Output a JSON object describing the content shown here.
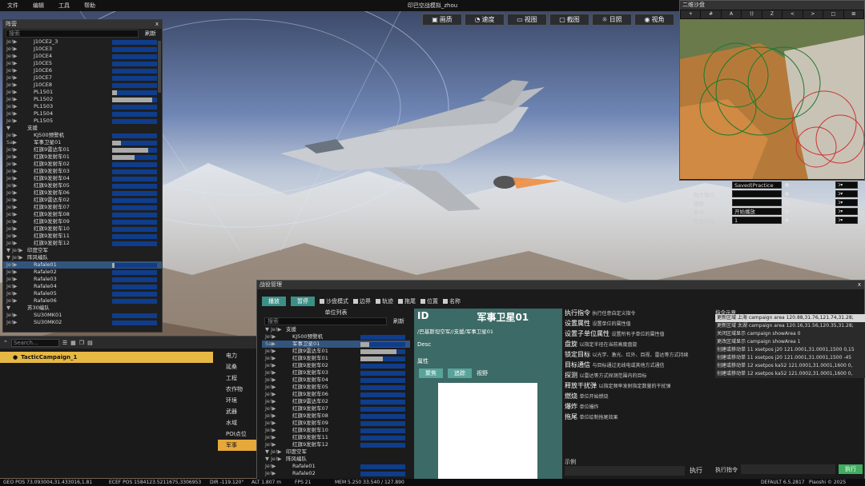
{
  "menu": {
    "items": [
      "文件",
      "编辑",
      "工具",
      "帮助"
    ],
    "title": "印巴空战模拟_zhou",
    "window_controls": [
      "—",
      "□",
      "✕"
    ]
  },
  "toolbar": [
    "画质",
    "速度",
    "视图",
    "截图",
    "日照",
    "视角"
  ],
  "formation_panel": {
    "title": "阵营",
    "close": "x",
    "search_placeholder": "搜索",
    "refresh": "刷新",
    "rows": [
      {
        "prefix": "Je!▶",
        "label": "J10CE2_3",
        "fill": 0
      },
      {
        "prefix": "Je!▶",
        "label": "J10CE3",
        "fill": 0
      },
      {
        "prefix": "Je!▶",
        "label": "J10CE4",
        "fill": 0
      },
      {
        "prefix": "Je!▶",
        "label": "J10CE5",
        "fill": 0
      },
      {
        "prefix": "Je!▶",
        "label": "J10CE6",
        "fill": 0
      },
      {
        "prefix": "Je!▶",
        "label": "J10CE7",
        "fill": 0
      },
      {
        "prefix": "Je!▶",
        "label": "J10CE8",
        "fill": 0
      },
      {
        "prefix": "Je!▶",
        "label": "PL1501",
        "fill": 0.1
      },
      {
        "prefix": "Je!▶",
        "label": "PL1502",
        "fill": 0.9
      },
      {
        "prefix": "Je!▶",
        "label": "PL1503",
        "fill": 0
      },
      {
        "prefix": "Je!▶",
        "label": "PL1504",
        "fill": 0
      },
      {
        "prefix": "Je!▶",
        "label": "PL1505",
        "fill": 0
      },
      {
        "prefix": "▼",
        "label": "支援",
        "fill": null
      },
      {
        "prefix": "Je!▶",
        "label": "KJ500预警机",
        "fill": 0
      },
      {
        "prefix": "Sa▶",
        "label": "军事卫星01",
        "fill": 0.2
      },
      {
        "prefix": "Je!▶",
        "label": "红旗9雷达车01",
        "fill": 0.8
      },
      {
        "prefix": "Je!▶",
        "label": "红旗9发射车01",
        "fill": 0.5
      },
      {
        "prefix": "Je!▶",
        "label": "红旗9发射车02",
        "fill": 0
      },
      {
        "prefix": "Je!▶",
        "label": "红旗9发射车03",
        "fill": 0
      },
      {
        "prefix": "Je!▶",
        "label": "红旗9发射车04",
        "fill": 0
      },
      {
        "prefix": "Je!▶",
        "label": "红旗9发射车05",
        "fill": 0
      },
      {
        "prefix": "Je!▶",
        "label": "红旗9发射车06",
        "fill": 0
      },
      {
        "prefix": "Je!▶",
        "label": "红旗9雷达车02",
        "fill": 0
      },
      {
        "prefix": "Je!▶",
        "label": "红旗9发射车07",
        "fill": 0
      },
      {
        "prefix": "Je!▶",
        "label": "红旗9发射车08",
        "fill": 0
      },
      {
        "prefix": "Je!▶",
        "label": "红旗9发射车09",
        "fill": 0
      },
      {
        "prefix": "Je!▶",
        "label": "红旗9发射车10",
        "fill": 0
      },
      {
        "prefix": "Je!▶",
        "label": "红旗9发射车11",
        "fill": 0
      },
      {
        "prefix": "Je!▶",
        "label": "红旗9发射车12",
        "fill": 0
      },
      {
        "prefix": "▼ Je!▶",
        "label": "印度空军",
        "fill": null
      },
      {
        "prefix": "▼ Je!▶",
        "label": "阵风编队",
        "fill": null
      },
      {
        "prefix": "Je!▶",
        "label": "Rafale01",
        "fill": 0.05,
        "selected": true
      },
      {
        "prefix": "Je!▶",
        "label": "Rafale02",
        "fill": 0
      },
      {
        "prefix": "Je!▶",
        "label": "Rafale03",
        "fill": 0
      },
      {
        "prefix": "Je!▶",
        "label": "Rafale04",
        "fill": 0
      },
      {
        "prefix": "Je!▶",
        "label": "Rafale05",
        "fill": 0
      },
      {
        "prefix": "Je!▶",
        "label": "Rafale06",
        "fill": 0
      },
      {
        "prefix": "▼",
        "label": "苏30编队",
        "fill": null
      },
      {
        "prefix": "Je!▶",
        "label": "SU30MK01",
        "fill": 0
      },
      {
        "prefix": "Je!▶",
        "label": "SU30MK02",
        "fill": 0
      }
    ]
  },
  "bottom": {
    "search_placeholder": "Search...",
    "campaign": "TacticCampaign_1",
    "categories": [
      "电力",
      "延桑",
      "工程",
      "农作物",
      "环境",
      "武器",
      "水域",
      "POI点位",
      "军事"
    ],
    "selected_category": "军事"
  },
  "map": {
    "title": "二维沙盘",
    "buttons": [
      "+",
      "#",
      "A",
      "()",
      "Z",
      "<",
      ">",
      "□",
      "⊞"
    ]
  },
  "settings": [
    {
      "label": "",
      "value": "Saved(Practice",
      "dd": "ↄ▾"
    },
    {
      "label": "独立窗口",
      "value": "",
      "dd": "ↄ▾"
    },
    {
      "label": "播放",
      "value": "",
      "dd": "ↄ▾"
    },
    {
      "label": "命令",
      "value": "开始播放",
      "dd": "ↄ▾"
    },
    {
      "label": "管理界面",
      "value": "1",
      "dd": "ↄ▾"
    }
  ],
  "war": {
    "title": "战役管理",
    "close": "x",
    "play": "播放",
    "pause": "暂停",
    "checks": [
      "沙盘模式",
      "边界",
      "轨迹",
      "拖尾",
      "位置",
      "名称"
    ],
    "unit_list_title": "单位列表",
    "search_placeholder": "搜索",
    "refresh": "刷新",
    "units": [
      {
        "prefix": "▼ Je!▶",
        "label": "支援",
        "fill": null
      },
      {
        "prefix": "Je!▶",
        "label": "KJ500预警机",
        "fill": 0
      },
      {
        "prefix": "Sa▶",
        "label": "军事卫星01",
        "fill": 0.2,
        "selected": true
      },
      {
        "prefix": "Je!▶",
        "label": "红旗9雷达车01",
        "fill": 0.8
      },
      {
        "prefix": "Je!▶",
        "label": "红旗9发射车01",
        "fill": 0.5
      },
      {
        "prefix": "Je!▶",
        "label": "红旗9发射车02",
        "fill": 0
      },
      {
        "prefix": "Je!▶",
        "label": "红旗9发射车03",
        "fill": 0
      },
      {
        "prefix": "Je!▶",
        "label": "红旗9发射车04",
        "fill": 0
      },
      {
        "prefix": "Je!▶",
        "label": "红旗9发射车05",
        "fill": 0
      },
      {
        "prefix": "Je!▶",
        "label": "红旗9发射车06",
        "fill": 0
      },
      {
        "prefix": "Je!▶",
        "label": "红旗9雷达车02",
        "fill": 0
      },
      {
        "prefix": "Je!▶",
        "label": "红旗9发射车07",
        "fill": 0
      },
      {
        "prefix": "Je!▶",
        "label": "红旗9发射车08",
        "fill": 0
      },
      {
        "prefix": "Je!▶",
        "label": "红旗9发射车09",
        "fill": 0
      },
      {
        "prefix": "Je!▶",
        "label": "红旗9发射车10",
        "fill": 0
      },
      {
        "prefix": "Je!▶",
        "label": "红旗9发射车11",
        "fill": 0
      },
      {
        "prefix": "Je!▶",
        "label": "红旗9发射车12",
        "fill": 0
      },
      {
        "prefix": "▼ Je!▶",
        "label": "印度空军",
        "fill": null
      },
      {
        "prefix": "▼ Je!▶",
        "label": "阵风编队",
        "fill": null
      },
      {
        "prefix": "Je!▶",
        "label": "Rafale01",
        "fill": 0
      },
      {
        "prefix": "Je!▶",
        "label": "Rafale02",
        "fill": 0
      }
    ],
    "info": {
      "id": "ID",
      "name": "军事卫星01",
      "path": "/巴基斯坦空军//支援/军事卫星01",
      "desc": "Desc",
      "attr": "属性",
      "follow": "聚焦",
      "track": "追踪",
      "view": "视野"
    },
    "commands": [
      {
        "name": "执行指令",
        "desc": "执行任意自定义指令"
      },
      {
        "name": "设置属性",
        "desc": "设置单位的属性值"
      },
      {
        "name": "设置子单位属性",
        "desc": "设置所有子单位的属性值"
      },
      {
        "name": "盘旋",
        "desc": "以指定半径在当前高度盘旋"
      },
      {
        "name": "锁定目标",
        "desc": "以光学、激光、红外、目视、雷达等方式持续"
      },
      {
        "name": "目标通信",
        "desc": "与目标通过无线电或其他方式通信"
      },
      {
        "name": "探测",
        "desc": "以雷达等方式探测范围内的目标"
      },
      {
        "name": "释放干扰弹",
        "desc": "以指定频率发射指定数量的干扰弹"
      },
      {
        "name": "燃烧",
        "desc": "单位开始燃烧"
      },
      {
        "name": "爆炸",
        "desc": "单位爆炸"
      },
      {
        "name": "拖尾",
        "desc": "单位绘制拖尾效果"
      }
    ],
    "example": "示例",
    "execute": "执行",
    "log_title": "指令示意",
    "logs": [
      "更新区域 上海 campaign area 120.88,31.76,121.74,31.28;",
      "更新区域 太湖 campaign area 120.16,31.56,120.35,31.28;",
      "关闭区域显示 campaign showArea 0",
      "更改区域显示 campaign showArea 1",
      "创建或移动单 11 xsetpos j20 121.0001,31.0001,1500 0,15",
      "创建或移动单 11 xsetpos j20 121.0001,31.0001,1500 -45",
      "创建或移动单 12 xsetpos ka52 121.0001,31.0001,1600 0,",
      "创建或移动单 12 xsetpos ka52 121.0002,31.0001,1600 0,"
    ],
    "exec_label": "执行指令",
    "exec_btn": "执行"
  },
  "status": {
    "geo": "GEO POS 73.093004,31.433016,1.81",
    "ecef": "ECEF POS 1584123.5211675,3306953",
    "dir": "DIR -119.120°",
    "alt": "ALT 1.807 m",
    "fps": "FPS 21",
    "mem": "MEM 5.250 33.540 / 127.890",
    "build": "DEFAULT 6.5.2817",
    "copy": "Piaoshi © 2025"
  }
}
